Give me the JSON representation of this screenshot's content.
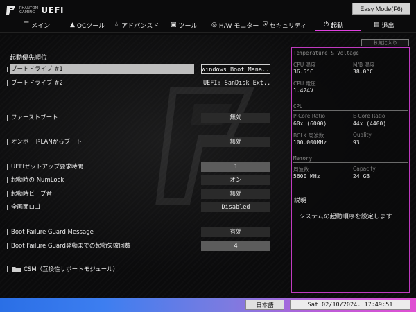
{
  "brand": {
    "line1": "PHANTOM",
    "line2": "GAMING",
    "uefi": "UEFI"
  },
  "easy_mode_label": "Easy Mode(F6)",
  "tabs": [
    {
      "label": "メイン",
      "icon": "list-icon"
    },
    {
      "label": "OCツール",
      "icon": "rocket-icon"
    },
    {
      "label": "アドバンスド",
      "icon": "star-icon"
    },
    {
      "label": "ツール",
      "icon": "briefcase-icon"
    },
    {
      "label": "H/W モニター",
      "icon": "monitor-gauge-icon"
    },
    {
      "label": "セキュリティ",
      "icon": "shield-icon"
    },
    {
      "label": "起動",
      "icon": "power-icon",
      "active": true
    },
    {
      "label": "退出",
      "icon": "exit-icon"
    }
  ],
  "help_button": "お気に入り",
  "main": {
    "section_title": "起動優先順位",
    "rows": [
      {
        "label": "ブートドライブ #1",
        "value": "Windows Boot Mana...",
        "selected": true
      },
      {
        "label": "ブートドライブ #2",
        "value": "UEFI: SanDisk Ext..."
      },
      {
        "label": "ファーストブート",
        "value": "無効"
      },
      {
        "label": "オンボードLANからブート",
        "value": "無効"
      },
      {
        "label": "UEFIセットアップ要求時間",
        "value": "1"
      },
      {
        "label": "起動時の NumLock",
        "value": "オン"
      },
      {
        "label": "起動時ビープ音",
        "value": "無効"
      },
      {
        "label": "全画面ロゴ",
        "value": "Disabled"
      },
      {
        "label": "Boot Failure Guard Message",
        "value": "有効"
      },
      {
        "label": "Boot Failure Guard発動までの起動失敗回数",
        "value": "4"
      }
    ],
    "csm_label": "CSM（互換性サポートモジュール）"
  },
  "panel": {
    "tv_header": "Temperature & Voltage",
    "cpu_temp_label": "CPU 温度",
    "cpu_temp_value": "36.5°C",
    "mb_temp_label": "M/B 温度",
    "mb_temp_value": "38.0°C",
    "cpu_volt_label": "CPU 電圧",
    "cpu_volt_value": "1.424V",
    "cpu_header": "CPU",
    "pcore_label": "P-Core Ratio",
    "pcore_value": "60x (6000)",
    "ecore_label": "E-Core Ratio",
    "ecore_value": "44x (4400)",
    "bclk_label": "BCLK 周波数",
    "bclk_value": "100.000MHz",
    "quality_label": "Quality",
    "quality_value": "93",
    "mem_header": "Memory",
    "freq_label": "周波数",
    "freq_value": "5600 MHz",
    "cap_label": "Capacity",
    "cap_value": "24 GB",
    "desc_title": "説明",
    "desc_text": "システムの起動順序を設定します"
  },
  "footer": {
    "language": "日本語",
    "datetime": "Sat 02/10/2024. 17:49:51"
  },
  "colors": {
    "accent": "#e040e0",
    "panel_border": "#c03ac0"
  }
}
